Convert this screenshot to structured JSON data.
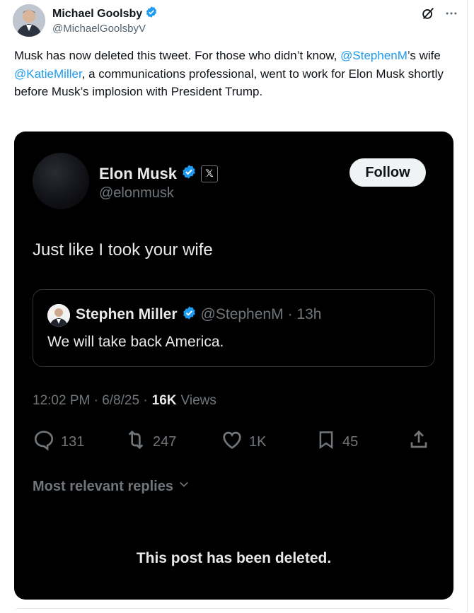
{
  "post": {
    "author_name": "Michael Goolsby",
    "author_handle": "@MichaelGoolsbyV",
    "text_prefix": "Musk has now deleted this tweet. For those who didn’t know, ",
    "mention_1": "@StephenM",
    "text_mid": "’s wife ",
    "mention_2": "@KatieMiller",
    "text_suffix": ", a communications professional, went to work for Elon Musk shortly before Musk’s implosion with President Trump."
  },
  "embed": {
    "author_name": "Elon Musk",
    "author_handle": "@elonmusk",
    "x_badge": "𝕏",
    "follow_label": "Follow",
    "text": "Just like I took your wife",
    "quote": {
      "author_name": "Stephen Miller",
      "author_handle": "@StephenM",
      "time": "· 13h",
      "text": "We will take back America."
    },
    "time": "12:02 PM · 6/8/25 ·",
    "views_count": "16K",
    "views_label": "Views",
    "replies": "131",
    "reposts": "247",
    "likes": "1K",
    "bookmarks": "45",
    "relevant_label": "Most relevant replies",
    "deleted_notice": "This post has been deleted."
  },
  "colors": {
    "link": "#1d9bf0",
    "verified": "#1d9bf0",
    "embed_bg": "#000000",
    "muted": "#71767b"
  },
  "icons": [
    "verified-badge-icon",
    "grok-icon",
    "more-icon",
    "reply-icon",
    "repost-icon",
    "like-icon",
    "bookmark-icon",
    "share-icon",
    "chevron-down-icon"
  ]
}
